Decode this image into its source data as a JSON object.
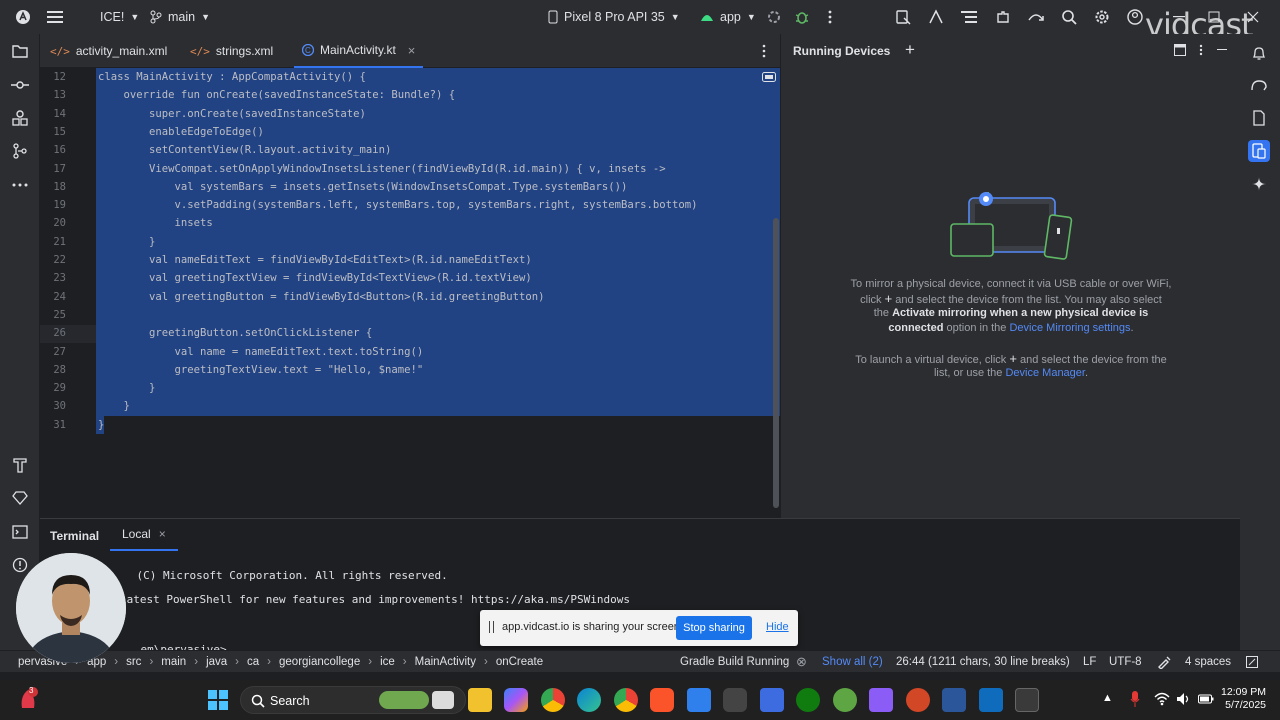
{
  "titlebar": {
    "project": "ICE!",
    "branch": "main",
    "device": "Pixel 8 Pro API 35",
    "run_config": "app",
    "watermark": "vidcast"
  },
  "tabs": [
    {
      "label": "activity_main.xml"
    },
    {
      "label": "strings.xml"
    },
    {
      "label": "MainActivity.kt"
    }
  ],
  "editor": {
    "lines": [
      {
        "n": "12",
        "code": "class MainActivity : AppCompatActivity() {"
      },
      {
        "n": "13",
        "code": "    override fun onCreate(savedInstanceState: Bundle?) {"
      },
      {
        "n": "14",
        "code": "        super.onCreate(savedInstanceState)"
      },
      {
        "n": "15",
        "code": "        enableEdgeToEdge()"
      },
      {
        "n": "16",
        "code": "        setContentView(R.layout.activity_main)"
      },
      {
        "n": "17",
        "code": "        ViewCompat.setOnApplyWindowInsetsListener(findViewById(R.id.main)) { v, insets ->"
      },
      {
        "n": "18",
        "code": "            val systemBars = insets.getInsets(WindowInsetsCompat.Type.systemBars())"
      },
      {
        "n": "19",
        "code": "            v.setPadding(systemBars.left, systemBars.top, systemBars.right, systemBars.bottom)"
      },
      {
        "n": "20",
        "code": "            insets"
      },
      {
        "n": "21",
        "code": "        }"
      },
      {
        "n": "22",
        "code": "        val nameEditText = findViewById<EditText>(R.id.nameEditText)"
      },
      {
        "n": "23",
        "code": "        val greetingTextView = findViewById<TextView>(R.id.textView)"
      },
      {
        "n": "24",
        "code": "        val greetingButton = findViewById<Button>(R.id.greetingButton)"
      },
      {
        "n": "25",
        "code": ""
      },
      {
        "n": "26",
        "code": "        greetingButton.setOnClickListener {"
      },
      {
        "n": "27",
        "code": "            val name = nameEditText.text.toString()"
      },
      {
        "n": "28",
        "code": "            greetingTextView.text = \"Hello, $name!\""
      },
      {
        "n": "29",
        "code": "        }"
      },
      {
        "n": "30",
        "code": "    }"
      },
      {
        "n": "31",
        "code": "}"
      }
    ]
  },
  "running_devices": {
    "title": "Running Devices",
    "mirror_1": "To mirror a physical device, connect it via USB cable or over WiFi,",
    "mirror_2a": "click",
    "mirror_2b": "and select the device from the list. You may also select",
    "mirror_3a": "the",
    "mirror_3b": "Activate mirroring when a new physical device is",
    "mirror_4a": "connected",
    "mirror_4b": "option in the",
    "mirror_4c": "Device Mirroring settings",
    "virtual_1a": "To launch a virtual device, click",
    "virtual_1b": "and select the device from the",
    "virtual_2a": "list, or use the",
    "virtual_2b": "Device Manager"
  },
  "terminal": {
    "tab_title": "Terminal",
    "tab_local": "Local",
    "line1": "(C) Microsoft Corporation. All rights reserved.",
    "line2": "latest PowerShell for new features and improvements! https://aka.ms/PSWindows",
    "line3": "em\\pervasive>"
  },
  "share_banner": {
    "message": "app.vidcast.io is sharing your screen.",
    "stop": "Stop sharing",
    "hide": "Hide"
  },
  "statusbar": {
    "crumbs": [
      "pervasive",
      "app",
      "src",
      "main",
      "java",
      "ca",
      "georgiancollege",
      "ice",
      "MainActivity",
      "onCreate"
    ],
    "task": "Gradle Build Running",
    "show_all": "Show all (2)",
    "position": "26:44 (1211 chars, 30 line breaks)",
    "line_sep": "LF",
    "encoding": "UTF-8",
    "indent": "4 spaces"
  },
  "taskbar": {
    "search": "Search",
    "time": "12:09 PM",
    "date": "5/7/2025",
    "badge": "3"
  },
  "colors": {
    "accent": "#3574f0",
    "selection": "#214283",
    "link": "#548af7"
  }
}
